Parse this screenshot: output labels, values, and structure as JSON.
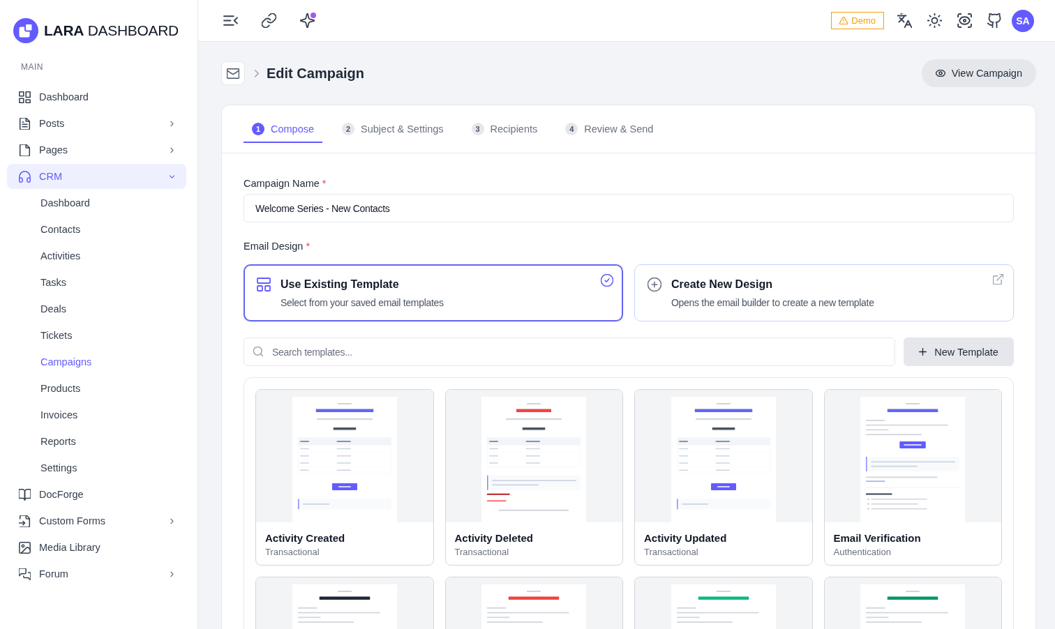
{
  "sidebar": {
    "logo": "**LARA** DASHBOARD",
    "section_label": "MAIN",
    "items": [
      {
        "label": "Dashboard",
        "kind": "link",
        "selected": false
      },
      {
        "label": "Posts",
        "kind": "group",
        "expanded": false,
        "selected": false
      },
      {
        "label": "Pages",
        "kind": "group",
        "expanded": false,
        "selected": false
      },
      {
        "label": "CRM",
        "kind": "group",
        "expanded": true,
        "selected": true,
        "children": [
          {
            "label": "Dashboard",
            "selected": false
          },
          {
            "label": "Contacts",
            "selected": false
          },
          {
            "label": "Activities",
            "selected": false
          },
          {
            "label": "Tasks",
            "selected": false
          },
          {
            "label": "Deals",
            "selected": false
          },
          {
            "label": "Tickets",
            "selected": false
          },
          {
            "label": "Campaigns",
            "selected": true
          },
          {
            "label": "Products",
            "selected": false
          },
          {
            "label": "Invoices",
            "selected": false
          },
          {
            "label": "Reports",
            "selected": false
          },
          {
            "label": "Settings",
            "selected": false
          }
        ]
      },
      {
        "label": "DocForge",
        "kind": "link",
        "selected": false
      },
      {
        "label": "Custom Forms",
        "kind": "group",
        "expanded": false,
        "selected": false
      },
      {
        "label": "Media Library",
        "kind": "link",
        "selected": false
      },
      {
        "label": "Forum",
        "kind": "group",
        "expanded": false,
        "selected": false
      }
    ]
  },
  "topbar": {
    "ai_notification": true,
    "demo_badge": "Demo",
    "avatar_initials": "SA"
  },
  "page_header": {
    "title": "Edit Campaign",
    "action": "View Campaign"
  },
  "steps": [
    {
      "number": "1",
      "label": "Compose",
      "selected": true
    },
    {
      "number": "2",
      "label": "Subject & Settings",
      "selected": false
    },
    {
      "number": "3",
      "label": "Recipients",
      "selected": false
    },
    {
      "number": "4",
      "label": "Review & Send",
      "selected": false
    }
  ],
  "campaign_name": {
    "label": "Campaign Name",
    "required_mark": "*",
    "value": "Welcome Series - New Contacts"
  },
  "email_design": {
    "label": "Email Design",
    "required_mark": "*",
    "options": [
      {
        "kind": "template",
        "title": "Use Existing Template",
        "description": "Select from your saved email templates",
        "selected": true
      },
      {
        "kind": "builder",
        "title": "Create New Design",
        "description": "Opens the email builder to create a new template",
        "selected": false
      }
    ]
  },
  "template_search": {
    "placeholder": "Search templates..."
  },
  "new_template_button": "New Template",
  "templates": [
    {
      "name": "Activity Created",
      "category": "Transactional",
      "kind": "record",
      "color": "#6366f1"
    },
    {
      "name": "Activity Deleted",
      "category": "Transactional",
      "kind": "notice",
      "color": "#ef4444"
    },
    {
      "name": "Activity Updated",
      "category": "Transactional",
      "kind": "record",
      "color": "#6366f1"
    },
    {
      "name": "Email Verification",
      "category": "Authentication",
      "kind": "letter",
      "color": "#6366f1"
    },
    {
      "kind": "letter",
      "color": "#1f2937"
    },
    {
      "kind": "letter",
      "color": "#ef4444"
    },
    {
      "kind": "letter",
      "color": "#10b981"
    },
    {
      "kind": "letter",
      "color": "#059669"
    }
  ]
}
